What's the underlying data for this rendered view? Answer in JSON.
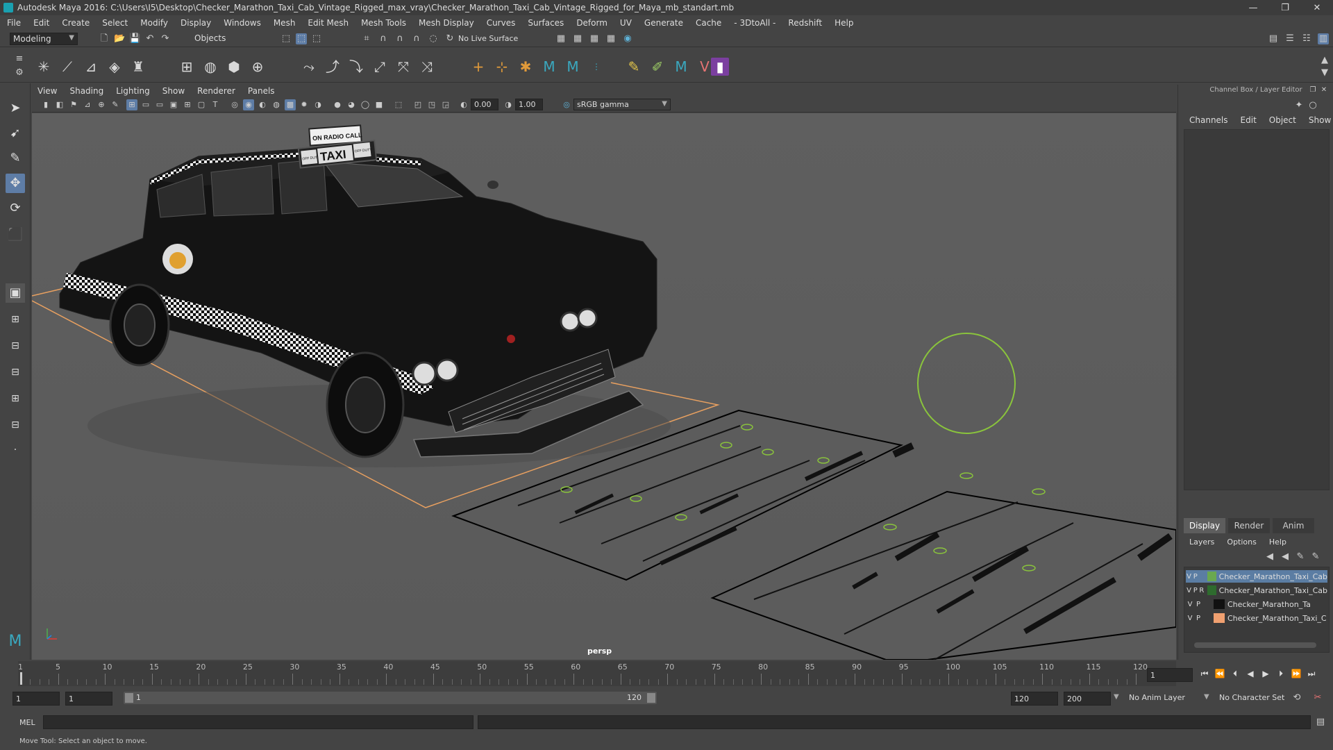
{
  "window": {
    "title": "Autodesk Maya 2016: C:\\Users\\I5\\Desktop\\Checker_Marathon_Taxi_Cab_Vintage_Rigged_max_vray\\Checker_Marathon_Taxi_Cab_Vintage_Rigged_for_Maya_mb_standart.mb",
    "minimize": "—",
    "maximize": "❐",
    "close": "✕"
  },
  "menubar": [
    "File",
    "Edit",
    "Create",
    "Select",
    "Modify",
    "Display",
    "Windows",
    "Mesh",
    "Edit Mesh",
    "Mesh Tools",
    "Mesh Display",
    "Curves",
    "Surfaces",
    "Deform",
    "UV",
    "Generate",
    "Cache",
    "- 3DtoAll -",
    "Redshift",
    "Help"
  ],
  "statusline": {
    "mode": "Modeling",
    "selection_mode": "Objects",
    "live_surface": "No Live Surface"
  },
  "viewport": {
    "menu": [
      "View",
      "Shading",
      "Lighting",
      "Show",
      "Renderer",
      "Panels"
    ],
    "exposure": "0.00",
    "gamma": "1.00",
    "color_space": "sRGB gamma",
    "camera": "persp",
    "decals": {
      "taxi_roof_top": "ON RADIO CALL",
      "taxi_roof_main": "TAXI",
      "taxi_roof_left": "OFF DUTY",
      "taxi_roof_right": "OFF DUTY"
    }
  },
  "channel_box": {
    "title": "Channel Box / Layer Editor",
    "tabs": [
      "Channels",
      "Edit",
      "Object",
      "Show"
    ]
  },
  "layer_editor": {
    "tabs": [
      "Display",
      "Render",
      "Anim"
    ],
    "active_tab": "Display",
    "menu": [
      "Layers",
      "Options",
      "Help"
    ],
    "layers": [
      {
        "v": "V",
        "p": "P",
        "r": "",
        "color": "#6aa84f",
        "name": "Checker_Marathon_Taxi_Cab",
        "selected": true
      },
      {
        "v": "V",
        "p": "P",
        "r": "R",
        "color": "#2e6b2e",
        "name": "Checker_Marathon_Taxi_Cab",
        "selected": false
      },
      {
        "v": "V",
        "p": "P",
        "r": "",
        "color": "#111111",
        "name": "Checker_Marathon_Ta",
        "selected": false
      },
      {
        "v": "V",
        "p": "P",
        "r": "",
        "color": "#f0a070",
        "name": "Checker_Marathon_Taxi_C",
        "selected": false
      }
    ]
  },
  "timeline": {
    "ticks": [
      "1",
      "5",
      "10",
      "15",
      "20",
      "25",
      "30",
      "35",
      "40",
      "45",
      "50",
      "55",
      "60",
      "65",
      "70",
      "75",
      "80",
      "85",
      "90",
      "95",
      "100",
      "105",
      "110",
      "115",
      "120"
    ],
    "current_frame": "1",
    "range_start": "1",
    "playback_start": "1",
    "range_bar_start": "1",
    "range_bar_end": "120",
    "playback_end": "120",
    "range_end": "200",
    "anim_layer": "No Anim Layer",
    "character_set": "No Character Set"
  },
  "command_line": {
    "language": "MEL"
  },
  "help_line": {
    "text": "Move Tool: Select an object to move."
  }
}
